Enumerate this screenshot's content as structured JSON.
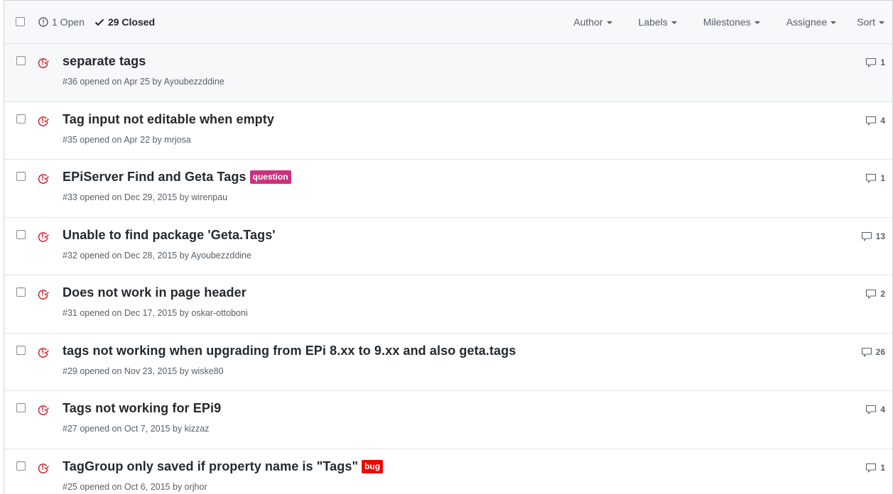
{
  "header": {
    "open_label": "1 Open",
    "closed_label": "29 Closed",
    "filters": {
      "author": "Author",
      "labels": "Labels",
      "milestones": "Milestones",
      "assignee": "Assignee",
      "sort": "Sort"
    }
  },
  "colors": {
    "closed_icon": "#cb2431",
    "label_question": "#cc317c",
    "label_bug": "#ee0701"
  },
  "issues": [
    {
      "title": "separate tags",
      "meta": "#36 opened on Apr 25 by Ayoubezzddine",
      "comments": "1",
      "label": ""
    },
    {
      "title": "Tag input not editable when empty",
      "meta": "#35 opened on Apr 22 by mrjosa",
      "comments": "4",
      "label": ""
    },
    {
      "title": "EPiServer Find and Geta Tags",
      "meta": "#33 opened on Dec 29, 2015 by wirenpau",
      "comments": "1",
      "label": "question"
    },
    {
      "title": "Unable to find package 'Geta.Tags'",
      "meta": "#32 opened on Dec 28, 2015 by Ayoubezzddine",
      "comments": "13",
      "label": ""
    },
    {
      "title": "Does not work in page header",
      "meta": "#31 opened on Dec 17, 2015 by oskar-ottoboni",
      "comments": "2",
      "label": ""
    },
    {
      "title": "tags not working when upgrading from EPi 8.xx to 9.xx and also geta.tags",
      "meta": "#29 opened on Nov 23, 2015 by wiske80",
      "comments": "26",
      "label": ""
    },
    {
      "title": "Tags not working for EPi9",
      "meta": "#27 opened on Oct 7, 2015 by kizzaz",
      "comments": "4",
      "label": ""
    },
    {
      "title": "TagGroup only saved if property name is \"Tags\"",
      "meta": "#25 opened on Oct 6, 2015 by orjhor",
      "comments": "1",
      "label": "bug"
    }
  ]
}
